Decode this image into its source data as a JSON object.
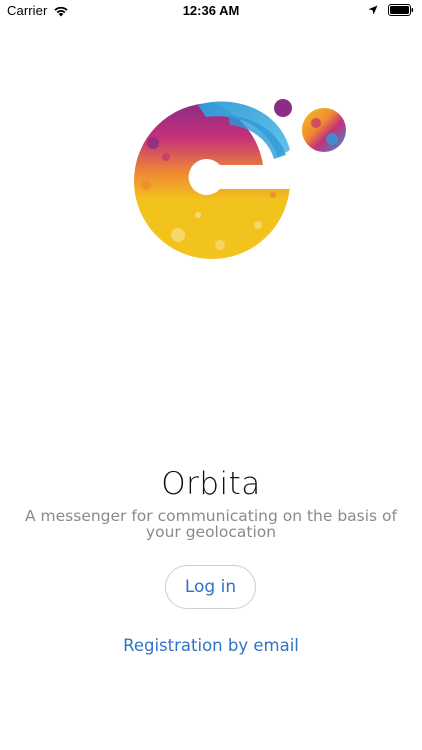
{
  "status_bar": {
    "carrier": "Carrier",
    "time": "12:36 AM"
  },
  "brand": {
    "title": "Orbita",
    "subtitle": "A messenger for communicating on the basis of your geolocation",
    "logo_icon": "orbita-logo",
    "colors": {
      "purple": "#8b2c86",
      "magenta": "#c4307a",
      "blue": "#2d9ad8",
      "orange": "#f08a32",
      "yellow": "#f2c21d"
    }
  },
  "actions": {
    "login_label": "Log in",
    "register_label": "Registration by email",
    "link_color": "#2f73c7"
  }
}
